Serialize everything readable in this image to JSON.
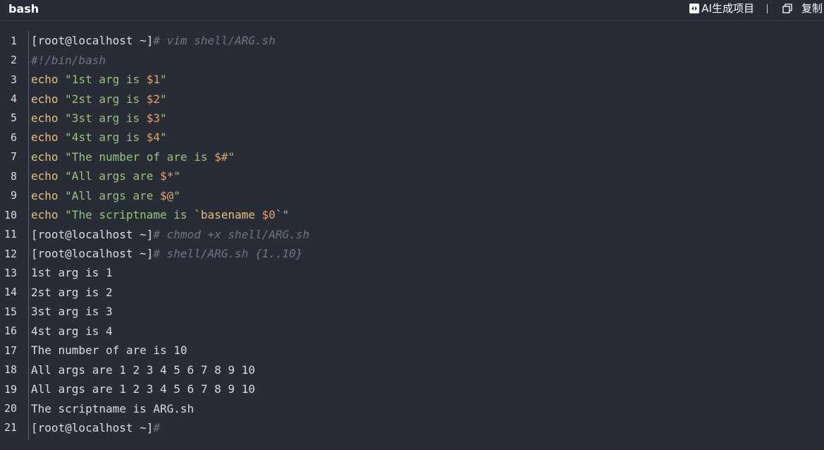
{
  "header": {
    "language": "bash",
    "ai_label": "AI生成项目",
    "copy_label": "复制"
  },
  "lines": [
    {
      "n": "1",
      "seg": [
        {
          "t": "plain",
          "v": "[root@localhost ~]"
        },
        {
          "t": "cmt",
          "v": "# vim shell/ARG.sh"
        }
      ]
    },
    {
      "n": "2",
      "seg": [
        {
          "t": "cmt",
          "v": "#!/bin/bash"
        }
      ]
    },
    {
      "n": "3",
      "seg": [
        {
          "t": "kw",
          "v": "echo"
        },
        {
          "t": "plain",
          "v": " "
        },
        {
          "t": "str",
          "v": "\"1st arg is "
        },
        {
          "t": "var",
          "v": "$1"
        },
        {
          "t": "str",
          "v": "\""
        }
      ]
    },
    {
      "n": "4",
      "seg": [
        {
          "t": "kw",
          "v": "echo"
        },
        {
          "t": "plain",
          "v": " "
        },
        {
          "t": "str",
          "v": "\"2st arg is "
        },
        {
          "t": "var",
          "v": "$2"
        },
        {
          "t": "str",
          "v": "\""
        }
      ]
    },
    {
      "n": "5",
      "seg": [
        {
          "t": "kw",
          "v": "echo"
        },
        {
          "t": "plain",
          "v": " "
        },
        {
          "t": "str",
          "v": "\"3st arg is "
        },
        {
          "t": "var",
          "v": "$3"
        },
        {
          "t": "str",
          "v": "\""
        }
      ]
    },
    {
      "n": "6",
      "seg": [
        {
          "t": "kw",
          "v": "echo"
        },
        {
          "t": "plain",
          "v": " "
        },
        {
          "t": "str",
          "v": "\"4st arg is "
        },
        {
          "t": "var",
          "v": "$4"
        },
        {
          "t": "str",
          "v": "\""
        }
      ]
    },
    {
      "n": "7",
      "seg": [
        {
          "t": "kw",
          "v": "echo"
        },
        {
          "t": "plain",
          "v": " "
        },
        {
          "t": "str",
          "v": "\"The number of are is "
        },
        {
          "t": "var",
          "v": "$#"
        },
        {
          "t": "str",
          "v": "\""
        }
      ]
    },
    {
      "n": "8",
      "seg": [
        {
          "t": "kw",
          "v": "echo"
        },
        {
          "t": "plain",
          "v": " "
        },
        {
          "t": "str",
          "v": "\"All args are "
        },
        {
          "t": "var",
          "v": "$*"
        },
        {
          "t": "str",
          "v": "\""
        }
      ]
    },
    {
      "n": "9",
      "seg": [
        {
          "t": "kw",
          "v": "echo"
        },
        {
          "t": "plain",
          "v": " "
        },
        {
          "t": "str",
          "v": "\"All args are "
        },
        {
          "t": "var",
          "v": "$@"
        },
        {
          "t": "str",
          "v": "\""
        }
      ]
    },
    {
      "n": "10",
      "seg": [
        {
          "t": "kw",
          "v": "echo"
        },
        {
          "t": "plain",
          "v": " "
        },
        {
          "t": "str",
          "v": "\"The scriptname is "
        },
        {
          "t": "kw",
          "v": "`basename "
        },
        {
          "t": "var",
          "v": "$0"
        },
        {
          "t": "kw",
          "v": "`"
        },
        {
          "t": "str",
          "v": "\""
        }
      ]
    },
    {
      "n": "11",
      "seg": [
        {
          "t": "plain",
          "v": "[root@localhost ~]"
        },
        {
          "t": "cmt",
          "v": "# chmod +x shell/ARG.sh"
        }
      ]
    },
    {
      "n": "12",
      "seg": [
        {
          "t": "plain",
          "v": "[root@localhost ~]"
        },
        {
          "t": "cmt",
          "v": "# shell/ARG.sh {1..10}"
        }
      ]
    },
    {
      "n": "13",
      "seg": [
        {
          "t": "plain",
          "v": "1st arg is 1"
        }
      ]
    },
    {
      "n": "14",
      "seg": [
        {
          "t": "plain",
          "v": "2st arg is 2"
        }
      ]
    },
    {
      "n": "15",
      "seg": [
        {
          "t": "plain",
          "v": "3st arg is 3"
        }
      ]
    },
    {
      "n": "16",
      "seg": [
        {
          "t": "plain",
          "v": "4st arg is 4"
        }
      ]
    },
    {
      "n": "17",
      "seg": [
        {
          "t": "plain",
          "v": "The number of are is 10"
        }
      ]
    },
    {
      "n": "18",
      "seg": [
        {
          "t": "plain",
          "v": "All args are 1 2 3 4 5 6 7 8 9 10"
        }
      ]
    },
    {
      "n": "19",
      "seg": [
        {
          "t": "plain",
          "v": "All args are 1 2 3 4 5 6 7 8 9 10"
        }
      ]
    },
    {
      "n": "20",
      "seg": [
        {
          "t": "plain",
          "v": "The scriptname is ARG.sh"
        }
      ]
    },
    {
      "n": "21",
      "seg": [
        {
          "t": "plain",
          "v": "[root@localhost ~]"
        },
        {
          "t": "cmt",
          "v": "#"
        }
      ]
    }
  ]
}
